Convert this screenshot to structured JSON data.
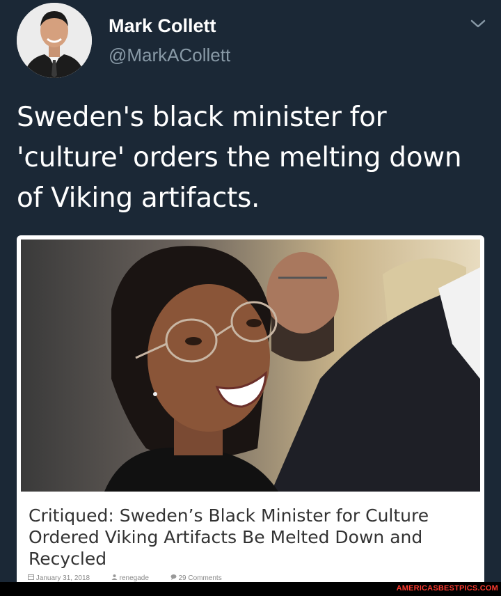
{
  "user": {
    "name": "Mark Collett",
    "handle": "@MarkACollett"
  },
  "tweet": {
    "text": "Sweden's black minister for 'culture' orders the melting down of Viking artifacts."
  },
  "card": {
    "title": "Critiqued: Sweden’s Black Minister for Culture Ordered Viking Artifacts Be Melted Down and Recycled",
    "date": "January 31, 2018",
    "author": "renegade",
    "comments": "29 Comments",
    "date_icon": "calendar-icon",
    "author_icon": "user-icon",
    "comments_icon": "comment-icon"
  },
  "icons": {
    "menu": "chevron-down-icon"
  },
  "footer": {
    "watermark": "AMERICASBESTPICS.COM"
  },
  "colors": {
    "background": "#1b2836",
    "handle": "#8899a6",
    "watermark": "#ff3b30"
  }
}
